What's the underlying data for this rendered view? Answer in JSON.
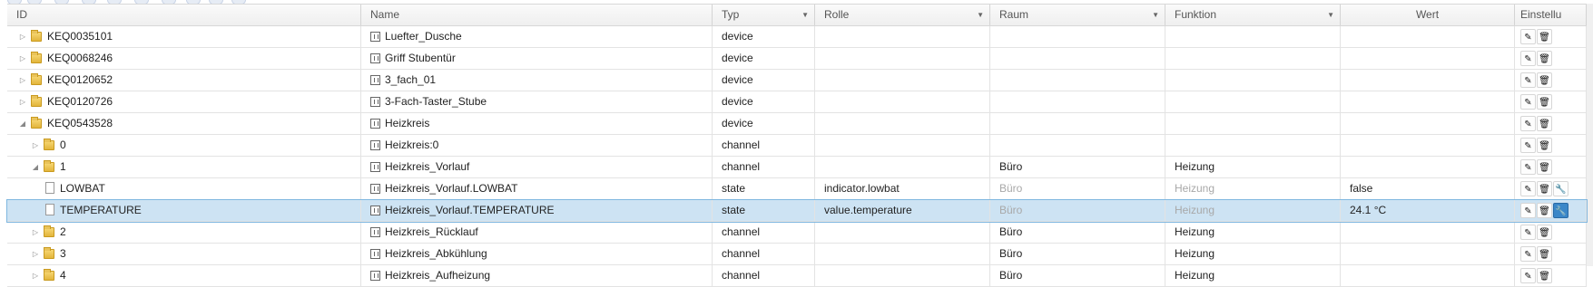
{
  "columns": {
    "id": "ID",
    "name": "Name",
    "typ": "Typ",
    "rolle": "Rolle",
    "raum": "Raum",
    "funktion": "Funktion",
    "wert": "Wert",
    "einstellungen": "Einstellu"
  },
  "rows": [
    {
      "id": "KEQ0035101",
      "name": "Luefter_Dusche",
      "typ": "device",
      "rolle": "",
      "raum": "",
      "funktion": "",
      "wert": ""
    },
    {
      "id": "KEQ0068246",
      "name": "Griff Stubentür",
      "typ": "device",
      "rolle": "",
      "raum": "",
      "funktion": "",
      "wert": ""
    },
    {
      "id": "KEQ0120652",
      "name": "3_fach_01",
      "typ": "device",
      "rolle": "",
      "raum": "",
      "funktion": "",
      "wert": ""
    },
    {
      "id": "KEQ0120726",
      "name": "3-Fach-Taster_Stube",
      "typ": "device",
      "rolle": "",
      "raum": "",
      "funktion": "",
      "wert": ""
    },
    {
      "id": "KEQ0543528",
      "name": "Heizkreis",
      "typ": "device",
      "rolle": "",
      "raum": "",
      "funktion": "",
      "wert": ""
    },
    {
      "id": "0",
      "name": "Heizkreis:0",
      "typ": "channel",
      "rolle": "",
      "raum": "",
      "funktion": "",
      "wert": ""
    },
    {
      "id": "1",
      "name": "Heizkreis_Vorlauf",
      "typ": "channel",
      "rolle": "",
      "raum": "Büro",
      "funktion": "Heizung",
      "wert": ""
    },
    {
      "id": "LOWBAT",
      "name": "Heizkreis_Vorlauf.LOWBAT",
      "typ": "state",
      "rolle": "indicator.lowbat",
      "raum": "Büro",
      "funktion": "Heizung",
      "wert": "false"
    },
    {
      "id": "TEMPERATURE",
      "name": "Heizkreis_Vorlauf.TEMPERATURE",
      "typ": "state",
      "rolle": "value.temperature",
      "raum": "Büro",
      "funktion": "Heizung",
      "wert": "24.1 °C"
    },
    {
      "id": "2",
      "name": "Heizkreis_Rücklauf",
      "typ": "channel",
      "rolle": "",
      "raum": "Büro",
      "funktion": "Heizung",
      "wert": ""
    },
    {
      "id": "3",
      "name": "Heizkreis_Abkühlung",
      "typ": "channel",
      "rolle": "",
      "raum": "Büro",
      "funktion": "Heizung",
      "wert": ""
    },
    {
      "id": "4",
      "name": "Heizkreis_Aufheizung",
      "typ": "channel",
      "rolle": "",
      "raum": "Büro",
      "funktion": "Heizung",
      "wert": ""
    }
  ],
  "icons": {
    "toggle_collapsed": "▷",
    "toggle_expanded": "◢",
    "sort_dropdown": "▼",
    "edit": "✎",
    "delete": "🗑",
    "settings": "🔧"
  }
}
